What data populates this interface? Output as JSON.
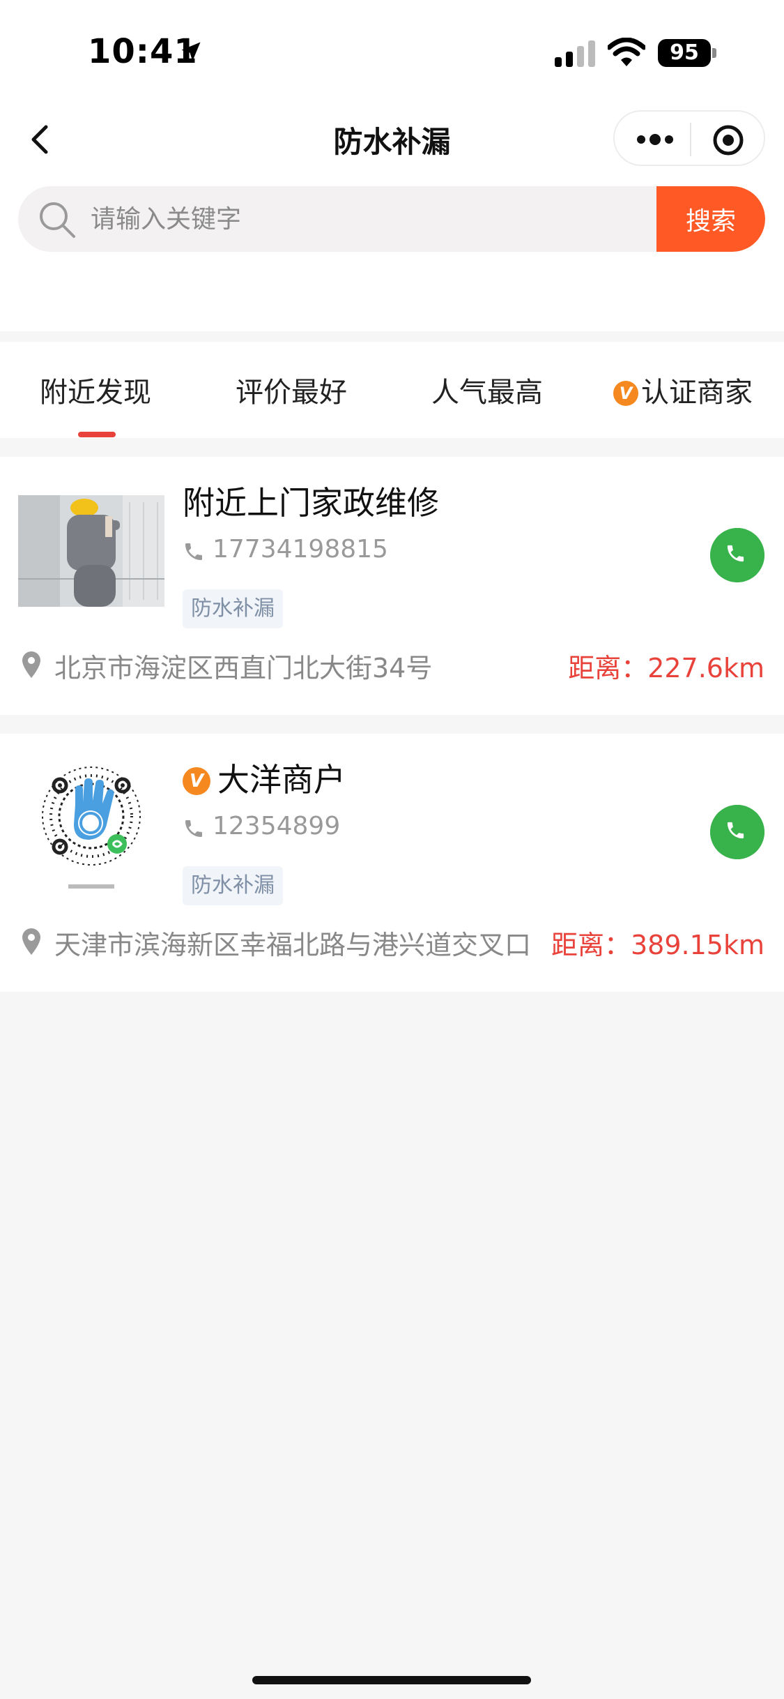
{
  "status_bar": {
    "time": "10:41",
    "battery": "95"
  },
  "nav": {
    "title": "防水补漏"
  },
  "search": {
    "placeholder": "请输入关键字",
    "button_label": "搜索"
  },
  "tabs": [
    {
      "label": "附近发现",
      "active": true
    },
    {
      "label": "评价最好",
      "active": false
    },
    {
      "label": "人气最高",
      "active": false
    },
    {
      "label": "认证商家",
      "active": false,
      "badge": "V"
    }
  ],
  "listings": [
    {
      "title": "附近上门家政维修",
      "verified": false,
      "phone": "17734198815",
      "tag": "防水补漏",
      "address": "北京市海淀区西直门北大街34号",
      "distance": "距离：227.6km"
    },
    {
      "title": "大洋商户",
      "verified": true,
      "badge": "V",
      "phone": "12354899",
      "tag": "防水补漏",
      "address": "天津市滨海新区幸福北路与港兴道交叉口",
      "distance": "距离：389.15km"
    }
  ],
  "colors": {
    "accent": "#ff5a26",
    "distance": "#e8423a",
    "call": "#38b24a",
    "verified": "#f5891f"
  }
}
